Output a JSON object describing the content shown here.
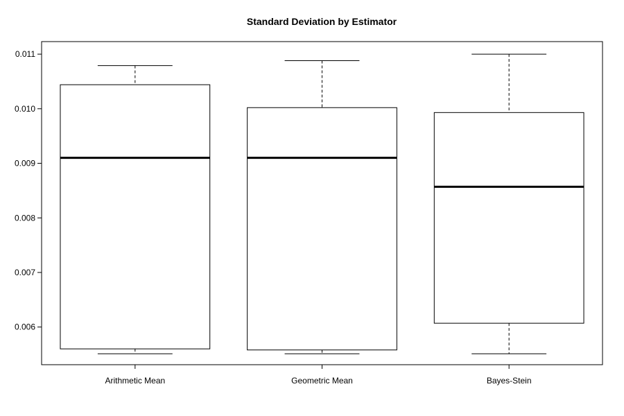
{
  "chart_data": {
    "type": "box",
    "title": "Standard Deviation by Estimator",
    "xlabel": "",
    "ylabel": "",
    "categories": [
      "Arithmetic Mean",
      "Geometric Mean",
      "Bayes-Stein"
    ],
    "boxes": [
      {
        "name": "Arithmetic Mean",
        "min": 0.00551,
        "q1": 0.0056,
        "median": 0.0091,
        "q3": 0.01044,
        "max": 0.01079
      },
      {
        "name": "Geometric Mean",
        "min": 0.00551,
        "q1": 0.00558,
        "median": 0.0091,
        "q3": 0.01002,
        "max": 0.01088
      },
      {
        "name": "Bayes-Stein",
        "min": 0.00551,
        "q1": 0.00607,
        "median": 0.00857,
        "q3": 0.00993,
        "max": 0.011
      }
    ],
    "ylim": [
      0.00531,
      0.01123
    ],
    "yticks": [
      0.006,
      0.007,
      0.008,
      0.009,
      0.01,
      0.011
    ],
    "ytick_labels": [
      "0.006",
      "0.007",
      "0.008",
      "0.009",
      "0.010",
      "0.011"
    ],
    "grid": false,
    "legend": "none",
    "colors": {
      "box_fill": "#ffffff",
      "stroke": "#000000"
    }
  }
}
